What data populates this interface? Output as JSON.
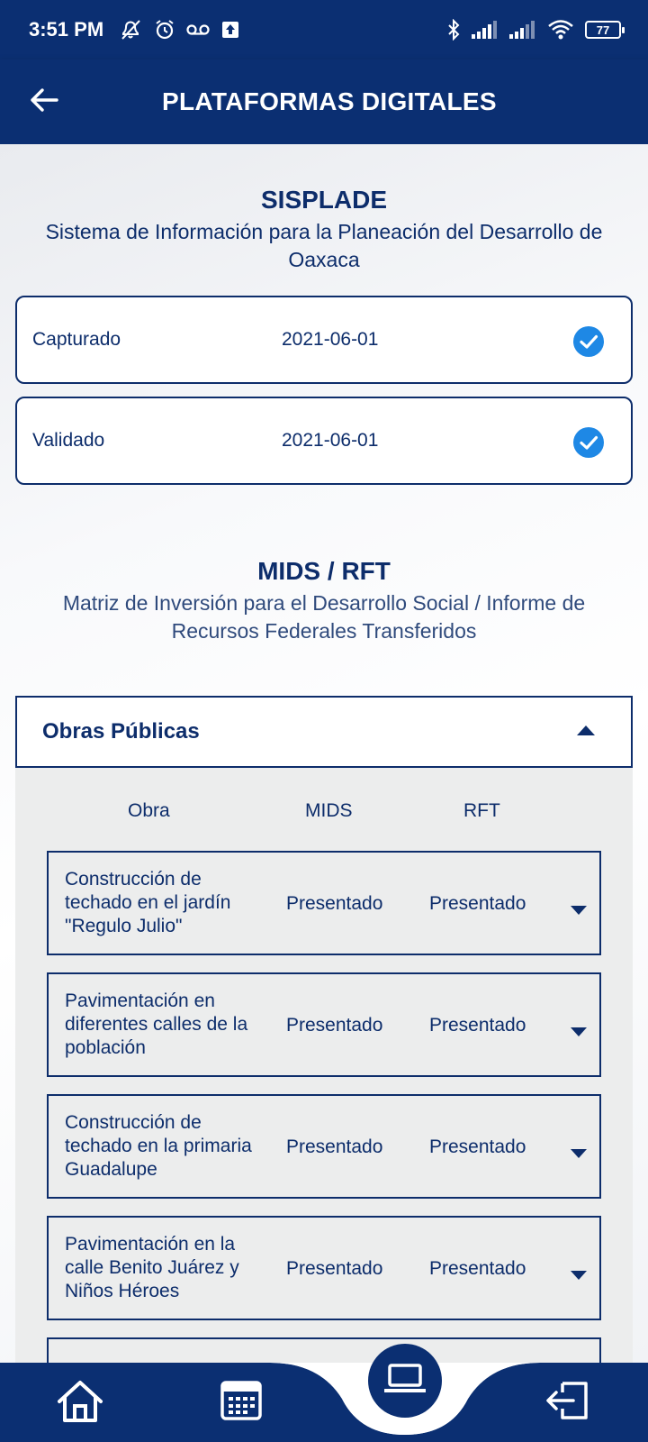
{
  "status_bar": {
    "time": "3:51 PM",
    "battery": "77",
    "icons": [
      "mute-icon",
      "alarm-icon",
      "voicemail-icon",
      "upload-icon",
      "bluetooth-icon",
      "signal-icon",
      "signal-icon",
      "wifi-icon",
      "battery-icon"
    ]
  },
  "header": {
    "title": "PLATAFORMAS DIGITALES",
    "back_icon": "back-arrow-icon"
  },
  "sisplade": {
    "title": "SISPLADE",
    "subtitle": "Sistema de Información para la Planeación del Desarrollo de Oaxaca",
    "items": [
      {
        "label": "Capturado",
        "date": "2021-06-01",
        "status_icon": "check-circle-icon"
      },
      {
        "label": "Validado",
        "date": "2021-06-01",
        "status_icon": "check-circle-icon"
      }
    ]
  },
  "mids": {
    "title": "MIDS / RFT",
    "subtitle": "Matriz de Inversión para el Desarrollo Social / Informe de Recursos Federales Transferidos"
  },
  "accordion": {
    "title": "Obras Públicas",
    "expanded_icon": "caret-up-icon",
    "columns": [
      "Obra",
      "MIDS",
      "RFT"
    ],
    "rows": [
      {
        "obra": "Construcción de techado en el jardín \"Regulo Julio\"",
        "mids": "Presentado",
        "rft": "Presentado"
      },
      {
        "obra": "Pavimentación en diferentes calles de la población",
        "mids": "Presentado",
        "rft": "Presentado"
      },
      {
        "obra": "Construcción de techado en la primaria Guadalupe",
        "mids": "Presentado",
        "rft": "Presentado"
      },
      {
        "obra": "Pavimentación en la calle Benito Juárez y Niños Héroes",
        "mids": "Presentado",
        "rft": "Presentado"
      }
    ]
  },
  "bottom_nav": {
    "items": [
      "home-icon",
      "calendar-icon",
      "laptop-icon",
      "logout-icon"
    ],
    "active": "laptop-icon"
  },
  "colors": {
    "primary": "#0b2f72",
    "text": "#0d2d6b",
    "check": "#1e88e5",
    "table_bg": "#eceded"
  }
}
